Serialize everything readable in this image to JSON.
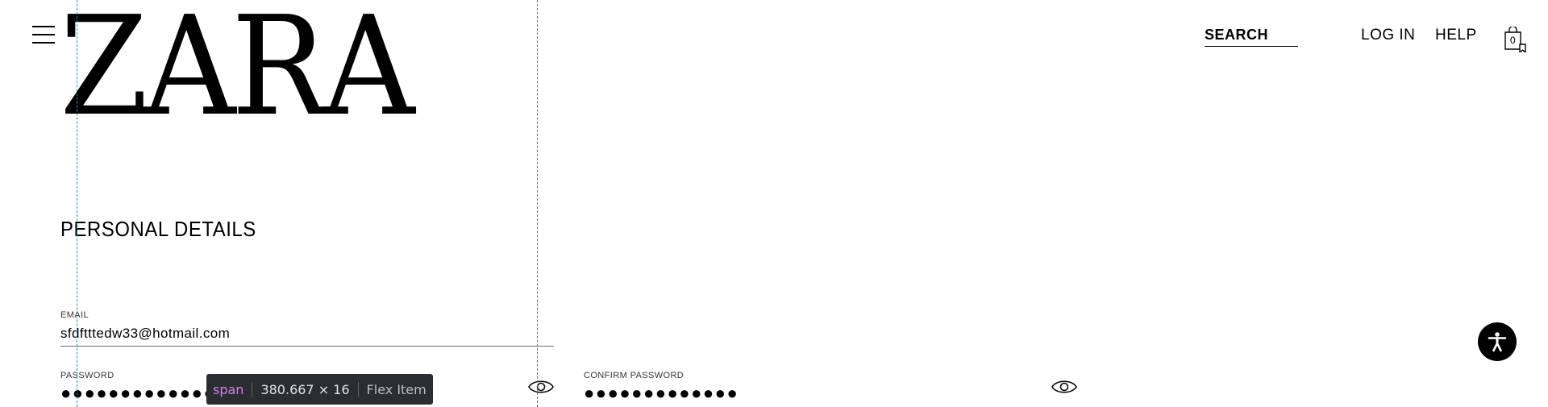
{
  "header": {
    "brand": "ZARA",
    "search_label": "SEARCH",
    "login_label": "LOG IN",
    "help_label": "HELP",
    "bag_count": "0"
  },
  "page": {
    "section_title": "PERSONAL DETAILS"
  },
  "form": {
    "email": {
      "label": "EMAIL",
      "value": "sfdftttedw33@hotmail.com"
    },
    "password": {
      "label": "PASSWORD",
      "value": "●●●●●●●●●●●●●"
    },
    "confirm_password": {
      "label": "CONFIRM PASSWORD",
      "value": "●●●●●●●●●●●●●"
    }
  },
  "devtools_tooltip": {
    "tag": "span",
    "dimensions": "380.667 × 16",
    "kind": "Flex Item"
  },
  "colors": {
    "guide": "#1a8fd6",
    "tooltip_bg": "#2b2d33",
    "tooltip_tag": "#d57fe4"
  },
  "icons": [
    "menu-icon",
    "bag-icon",
    "eye-icon",
    "accessibility-icon"
  ]
}
